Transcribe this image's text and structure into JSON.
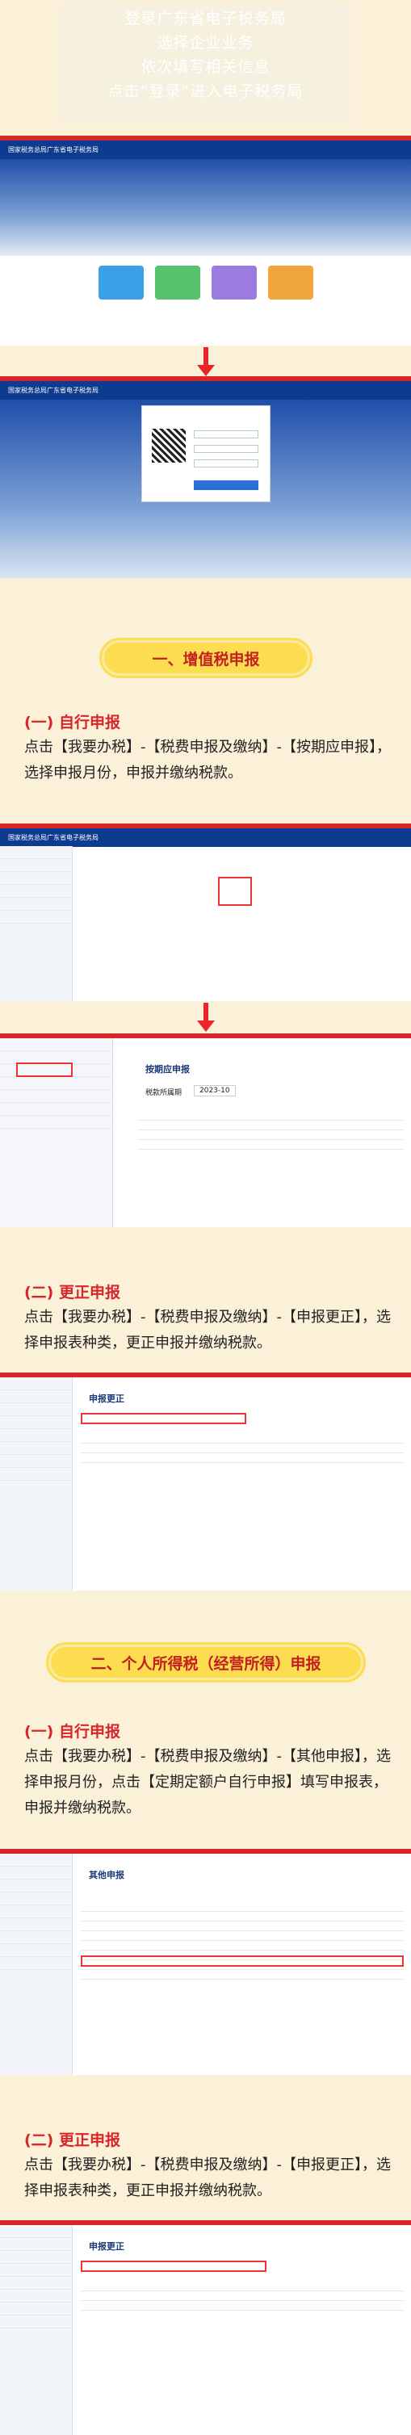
{
  "intro": {
    "lines": [
      "登录广东省电子税务局",
      "选择企业业务",
      "依次填写相关信息",
      "点击“登录”进入电子税务局"
    ]
  },
  "screens": {
    "portal_title": "国家税务总局广东省电子税务局",
    "login_title": "国家税务总局广东省电子税务局",
    "etax_title": "国家税务总局广东省电子税务局",
    "quarterly_title": "按期应申报",
    "period_label": "税款所属期",
    "period_value": "2023-10",
    "correction_title": "申报更正",
    "other_title": "其他申报"
  },
  "sections": {
    "vat": {
      "header": "一、增值税申报",
      "normal_title": "(一) 自行申报",
      "normal_text": "点击【我要办税】-【税费申报及缴纳】-【按期应申报】，选择申报月份，申报并缴纳税款。",
      "correct_title": "(二) 更正申报",
      "correct_text": "点击【我要办税】-【税费申报及缴纳】-【申报更正】，选择申报表种类，更正申报并缴纳税款。"
    },
    "iit": {
      "header": "二、个人所得税（经营所得）申报",
      "normal_title": "(一) 自行申报",
      "normal_text": "点击【我要办税】-【税费申报及缴纳】-【其他申报】，选择申报月份，点击【定期定额户自行申报】填写申报表，申报并缴纳税款。",
      "correct_title": "(二) 更正申报",
      "correct_text": "点击【我要办税】-【税费申报及缴纳】-【申报更正】，选择申报表种类，更正申报并缴纳税款。"
    }
  },
  "colors": {
    "accent": "#d7262a",
    "pill": "#fbdd4f",
    "bg": "#fbf1d8"
  }
}
